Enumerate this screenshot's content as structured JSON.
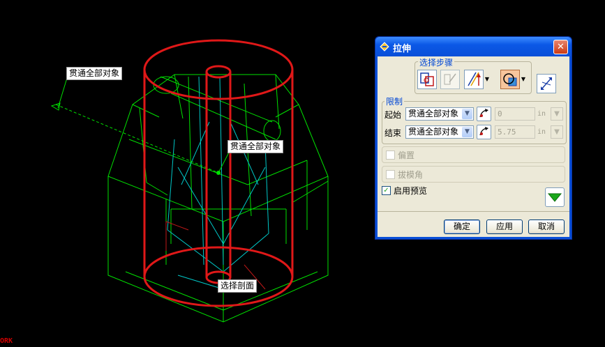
{
  "viewport": {
    "labels": {
      "top_label": "贯通全部对象",
      "mid_label": "贯通全部对象",
      "bottom_label": "选择剖面"
    },
    "corner_text": "ORK"
  },
  "dialog": {
    "title": "拉伸",
    "close_icon": "close-icon",
    "steps": {
      "title": "选择步骤",
      "icons": [
        "section-select-icon",
        "target-select-icon",
        "direction-vector-icon",
        "boolean-op-icon",
        "reverse-direction-icon"
      ]
    },
    "limits": {
      "title": "限制",
      "start": {
        "label": "起始",
        "value": "贯通全部对象",
        "distance": "0",
        "unit": "in"
      },
      "end": {
        "label": "结束",
        "value": "贯通全部对象",
        "distance": "5.75",
        "unit": "in"
      }
    },
    "offset": {
      "label": "偏置",
      "checked": false,
      "enabled": false
    },
    "draft": {
      "label": "拔模角",
      "checked": false,
      "enabled": false
    },
    "preview": {
      "label": "启用预览",
      "checked": true
    },
    "expand_icon": "expand-down-icon",
    "buttons": {
      "ok": "确定",
      "apply": "应用",
      "cancel": "取消"
    },
    "colors": {
      "accent": "#0a4fd8",
      "face": "#ece9d8",
      "expand": "#1aa81a"
    }
  }
}
